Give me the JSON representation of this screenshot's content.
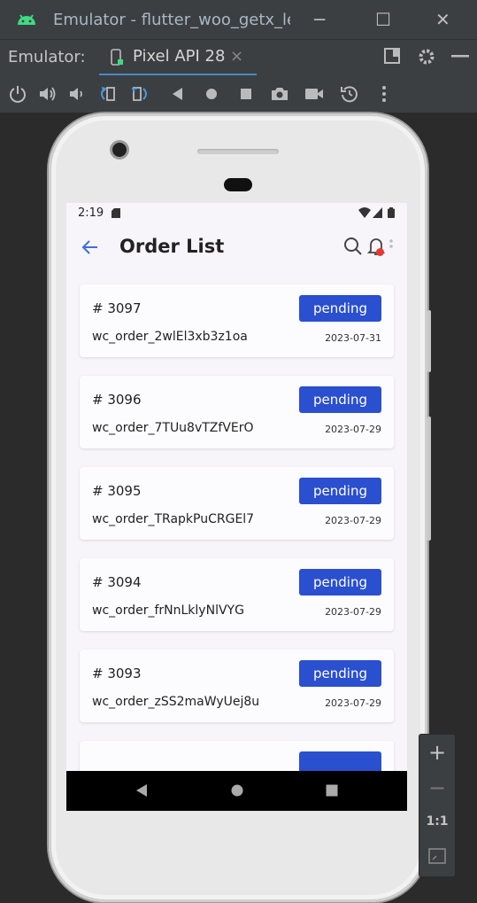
{
  "window": {
    "title": "Emulator - flutter_woo_getx_le",
    "minimize_glyph": "─",
    "maximize_glyph": "☐",
    "close_glyph": "✕"
  },
  "tabbar": {
    "label": "Emulator:",
    "tab_name": "Pixel API 28",
    "tab_close": "×"
  },
  "toolbar": {
    "icons": [
      "power-icon",
      "volume-up-icon",
      "volume-down-icon",
      "rotate-left-icon",
      "rotate-right-icon",
      "back-icon",
      "home-icon",
      "overview-icon",
      "screenshot-icon",
      "screen-record-icon",
      "snapshot-icon",
      "more-icon"
    ]
  },
  "device": {
    "status": {
      "time": "2:19"
    },
    "appbar": {
      "title": "Order List"
    },
    "orders": [
      {
        "number": "# 3097",
        "code": "wc_order_2wlEl3xb3z1oa",
        "date": "2023-07-31",
        "status": "pending"
      },
      {
        "number": "# 3096",
        "code": "wc_order_7TUu8vTZfVErO",
        "date": "2023-07-29",
        "status": "pending"
      },
      {
        "number": "# 3095",
        "code": "wc_order_TRapkPuCRGEl7",
        "date": "2023-07-29",
        "status": "pending"
      },
      {
        "number": "# 3094",
        "code": "wc_order_frNnLklyNlVYG",
        "date": "2023-07-29",
        "status": "pending"
      },
      {
        "number": "# 3093",
        "code": "wc_order_zSS2maWyUej8u",
        "date": "2023-07-29",
        "status": "pending"
      }
    ]
  },
  "zoom": {
    "plus": "+",
    "minus": "−",
    "one_to_one": "1:1"
  },
  "colors": {
    "accent": "#2a4fcf",
    "ide_bg": "#3c3f41",
    "tab_underline": "#4a88c7",
    "notification_dot": "#e53935"
  }
}
